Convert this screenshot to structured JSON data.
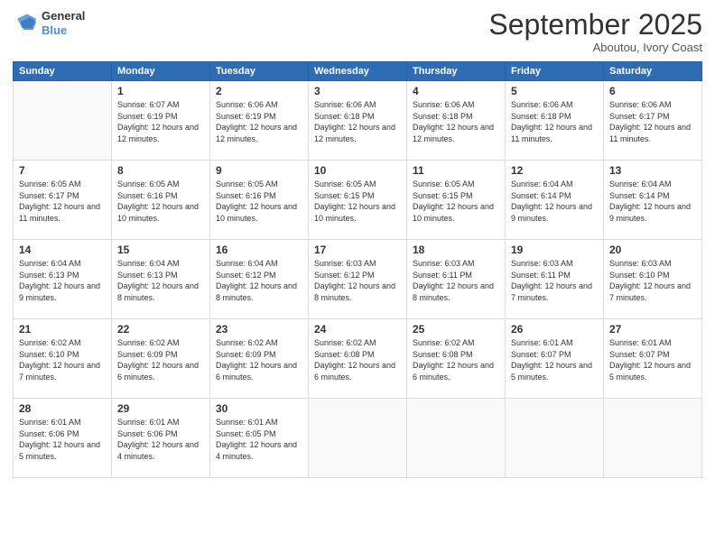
{
  "header": {
    "logo": {
      "line1": "General",
      "line2": "Blue"
    },
    "title": "September 2025",
    "location": "Aboutou, Ivory Coast"
  },
  "weekdays": [
    "Sunday",
    "Monday",
    "Tuesday",
    "Wednesday",
    "Thursday",
    "Friday",
    "Saturday"
  ],
  "weeks": [
    [
      {
        "day": "",
        "sunrise": "",
        "sunset": "",
        "daylight": ""
      },
      {
        "day": "1",
        "sunrise": "Sunrise: 6:07 AM",
        "sunset": "Sunset: 6:19 PM",
        "daylight": "Daylight: 12 hours and 12 minutes."
      },
      {
        "day": "2",
        "sunrise": "Sunrise: 6:06 AM",
        "sunset": "Sunset: 6:19 PM",
        "daylight": "Daylight: 12 hours and 12 minutes."
      },
      {
        "day": "3",
        "sunrise": "Sunrise: 6:06 AM",
        "sunset": "Sunset: 6:18 PM",
        "daylight": "Daylight: 12 hours and 12 minutes."
      },
      {
        "day": "4",
        "sunrise": "Sunrise: 6:06 AM",
        "sunset": "Sunset: 6:18 PM",
        "daylight": "Daylight: 12 hours and 12 minutes."
      },
      {
        "day": "5",
        "sunrise": "Sunrise: 6:06 AM",
        "sunset": "Sunset: 6:18 PM",
        "daylight": "Daylight: 12 hours and 11 minutes."
      },
      {
        "day": "6",
        "sunrise": "Sunrise: 6:06 AM",
        "sunset": "Sunset: 6:17 PM",
        "daylight": "Daylight: 12 hours and 11 minutes."
      }
    ],
    [
      {
        "day": "7",
        "sunrise": "Sunrise: 6:05 AM",
        "sunset": "Sunset: 6:17 PM",
        "daylight": "Daylight: 12 hours and 11 minutes."
      },
      {
        "day": "8",
        "sunrise": "Sunrise: 6:05 AM",
        "sunset": "Sunset: 6:16 PM",
        "daylight": "Daylight: 12 hours and 10 minutes."
      },
      {
        "day": "9",
        "sunrise": "Sunrise: 6:05 AM",
        "sunset": "Sunset: 6:16 PM",
        "daylight": "Daylight: 12 hours and 10 minutes."
      },
      {
        "day": "10",
        "sunrise": "Sunrise: 6:05 AM",
        "sunset": "Sunset: 6:15 PM",
        "daylight": "Daylight: 12 hours and 10 minutes."
      },
      {
        "day": "11",
        "sunrise": "Sunrise: 6:05 AM",
        "sunset": "Sunset: 6:15 PM",
        "daylight": "Daylight: 12 hours and 10 minutes."
      },
      {
        "day": "12",
        "sunrise": "Sunrise: 6:04 AM",
        "sunset": "Sunset: 6:14 PM",
        "daylight": "Daylight: 12 hours and 9 minutes."
      },
      {
        "day": "13",
        "sunrise": "Sunrise: 6:04 AM",
        "sunset": "Sunset: 6:14 PM",
        "daylight": "Daylight: 12 hours and 9 minutes."
      }
    ],
    [
      {
        "day": "14",
        "sunrise": "Sunrise: 6:04 AM",
        "sunset": "Sunset: 6:13 PM",
        "daylight": "Daylight: 12 hours and 9 minutes."
      },
      {
        "day": "15",
        "sunrise": "Sunrise: 6:04 AM",
        "sunset": "Sunset: 6:13 PM",
        "daylight": "Daylight: 12 hours and 8 minutes."
      },
      {
        "day": "16",
        "sunrise": "Sunrise: 6:04 AM",
        "sunset": "Sunset: 6:12 PM",
        "daylight": "Daylight: 12 hours and 8 minutes."
      },
      {
        "day": "17",
        "sunrise": "Sunrise: 6:03 AM",
        "sunset": "Sunset: 6:12 PM",
        "daylight": "Daylight: 12 hours and 8 minutes."
      },
      {
        "day": "18",
        "sunrise": "Sunrise: 6:03 AM",
        "sunset": "Sunset: 6:11 PM",
        "daylight": "Daylight: 12 hours and 8 minutes."
      },
      {
        "day": "19",
        "sunrise": "Sunrise: 6:03 AM",
        "sunset": "Sunset: 6:11 PM",
        "daylight": "Daylight: 12 hours and 7 minutes."
      },
      {
        "day": "20",
        "sunrise": "Sunrise: 6:03 AM",
        "sunset": "Sunset: 6:10 PM",
        "daylight": "Daylight: 12 hours and 7 minutes."
      }
    ],
    [
      {
        "day": "21",
        "sunrise": "Sunrise: 6:02 AM",
        "sunset": "Sunset: 6:10 PM",
        "daylight": "Daylight: 12 hours and 7 minutes."
      },
      {
        "day": "22",
        "sunrise": "Sunrise: 6:02 AM",
        "sunset": "Sunset: 6:09 PM",
        "daylight": "Daylight: 12 hours and 6 minutes."
      },
      {
        "day": "23",
        "sunrise": "Sunrise: 6:02 AM",
        "sunset": "Sunset: 6:09 PM",
        "daylight": "Daylight: 12 hours and 6 minutes."
      },
      {
        "day": "24",
        "sunrise": "Sunrise: 6:02 AM",
        "sunset": "Sunset: 6:08 PM",
        "daylight": "Daylight: 12 hours and 6 minutes."
      },
      {
        "day": "25",
        "sunrise": "Sunrise: 6:02 AM",
        "sunset": "Sunset: 6:08 PM",
        "daylight": "Daylight: 12 hours and 6 minutes."
      },
      {
        "day": "26",
        "sunrise": "Sunrise: 6:01 AM",
        "sunset": "Sunset: 6:07 PM",
        "daylight": "Daylight: 12 hours and 5 minutes."
      },
      {
        "day": "27",
        "sunrise": "Sunrise: 6:01 AM",
        "sunset": "Sunset: 6:07 PM",
        "daylight": "Daylight: 12 hours and 5 minutes."
      }
    ],
    [
      {
        "day": "28",
        "sunrise": "Sunrise: 6:01 AM",
        "sunset": "Sunset: 6:06 PM",
        "daylight": "Daylight: 12 hours and 5 minutes."
      },
      {
        "day": "29",
        "sunrise": "Sunrise: 6:01 AM",
        "sunset": "Sunset: 6:06 PM",
        "daylight": "Daylight: 12 hours and 4 minutes."
      },
      {
        "day": "30",
        "sunrise": "Sunrise: 6:01 AM",
        "sunset": "Sunset: 6:05 PM",
        "daylight": "Daylight: 12 hours and 4 minutes."
      },
      {
        "day": "",
        "sunrise": "",
        "sunset": "",
        "daylight": ""
      },
      {
        "day": "",
        "sunrise": "",
        "sunset": "",
        "daylight": ""
      },
      {
        "day": "",
        "sunrise": "",
        "sunset": "",
        "daylight": ""
      },
      {
        "day": "",
        "sunrise": "",
        "sunset": "",
        "daylight": ""
      }
    ]
  ]
}
